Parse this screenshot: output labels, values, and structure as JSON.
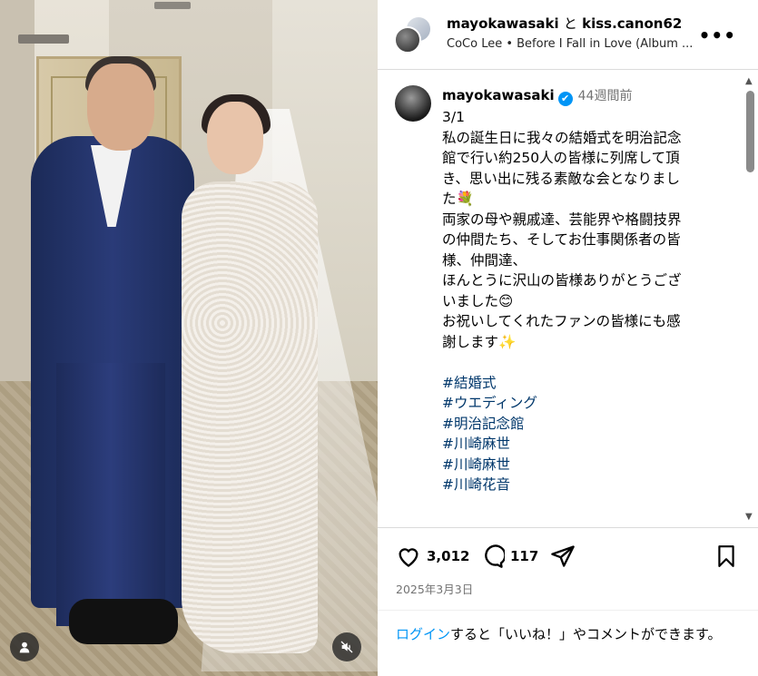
{
  "photo": {
    "user_icon": "person-icon",
    "mute_icon": "muted-speaker-icon"
  },
  "header": {
    "user1": "mayokawasaki",
    "and": "と",
    "user2": "kiss.canon62",
    "music": "CoCo Lee • Before I Fall in Love (Album ...",
    "more": "•••"
  },
  "caption": {
    "username": "mayokawasaki",
    "verified": "✔",
    "time": "44週間前",
    "lines": [
      "3/1",
      "私の誕生日に我々の結婚式を明治記念",
      "館で行い約250人の皆様に列席して頂",
      "き、思い出に残る素敵な会となりまし",
      "た💐",
      "両家の母や親戚達、芸能界や格闘技界",
      "の仲間たち、そしてお仕事関係者の皆",
      "様、仲間達、",
      "ほんとうに沢山の皆様ありがとうござ",
      "いました😊",
      "お祝いしてくれたファンの皆様にも感",
      "謝します✨"
    ],
    "tags": [
      "#結婚式",
      "#ウエディング",
      "#明治記念館",
      "#川崎麻世",
      "#川崎麻世",
      "#川崎花音"
    ]
  },
  "actions": {
    "likes": "3,012",
    "comments": "117"
  },
  "date": "2025年3月3日",
  "login": {
    "link": "ログイン",
    "rest": "すると「いいね！」やコメントができます。"
  },
  "colors": {
    "link": "#0095f6",
    "hashtag": "#00376b",
    "verified": "#0095f6",
    "muted_text": "#737373"
  }
}
